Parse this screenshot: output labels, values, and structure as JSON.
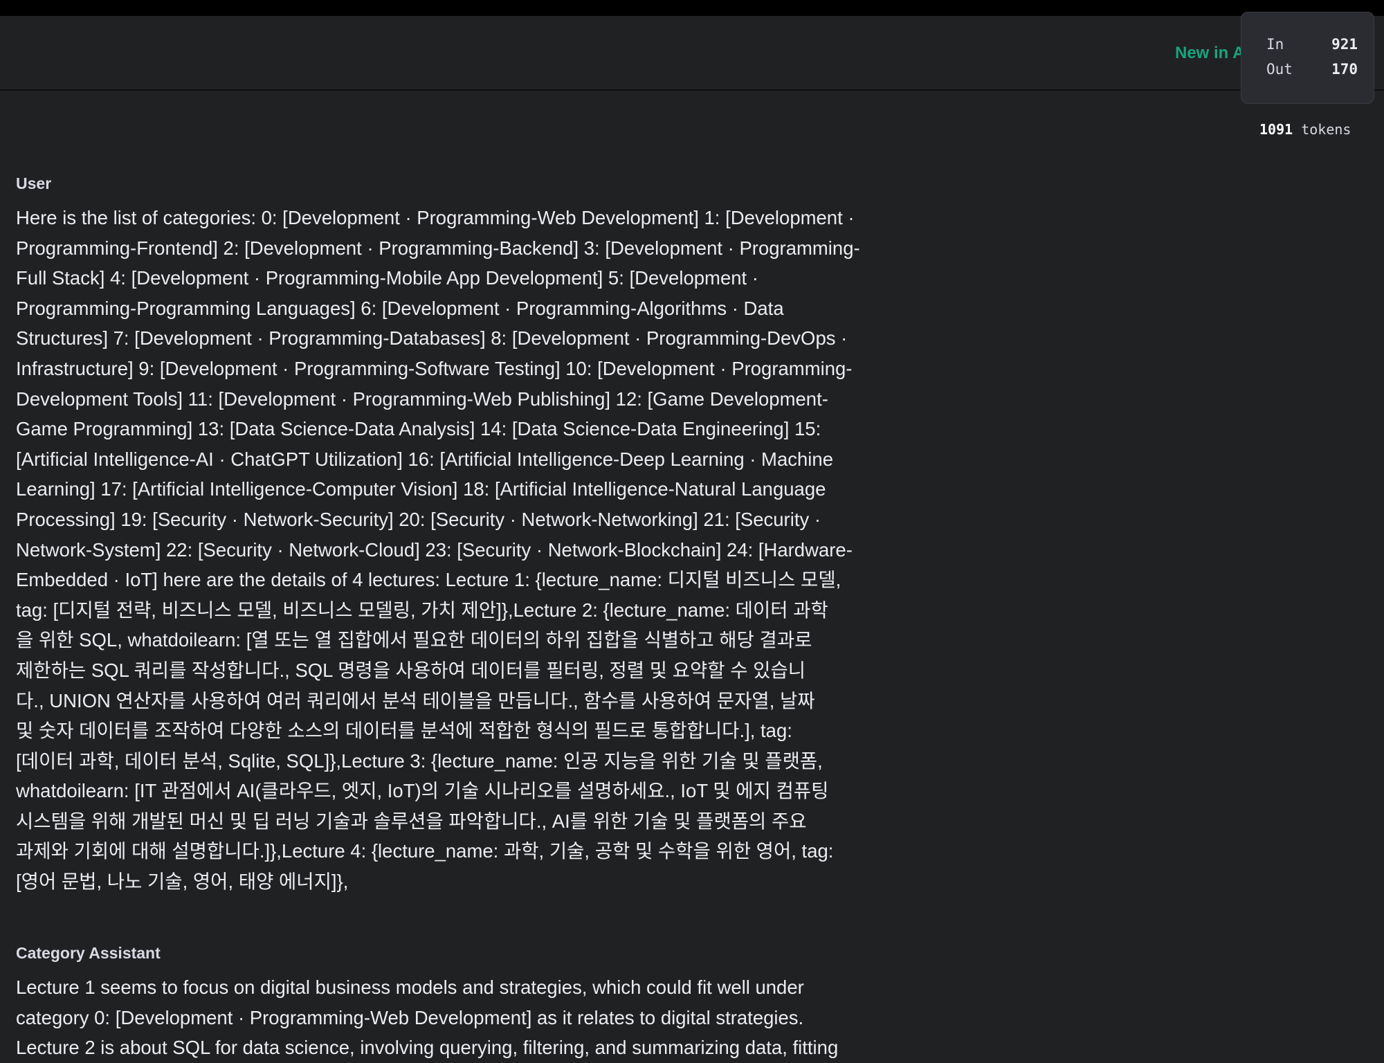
{
  "header": {
    "new_label": "New in A"
  },
  "stats": {
    "in_label": "In",
    "in_value": "921",
    "out_label": "Out",
    "out_value": "170",
    "tokens_count": "1091",
    "tokens_unit": "tokens"
  },
  "messages": [
    {
      "role": "User",
      "lines": [
        "Here is the list of categories: 0: [Development · Programming-Web Development] 1: [Development ·",
        "Programming-Frontend] 2: [Development · Programming-Backend] 3: [Development · Programming-",
        "Full Stack] 4: [Development · Programming-Mobile App Development] 5: [Development ·",
        "Programming-Programming Languages] 6: [Development · Programming-Algorithms · Data",
        "Structures] 7: [Development · Programming-Databases] 8: [Development · Programming-DevOps ·",
        "Infrastructure] 9: [Development · Programming-Software Testing] 10: [Development · Programming-",
        "Development Tools] 11: [Development · Programming-Web Publishing] 12: [Game Development-",
        "Game Programming] 13: [Data Science-Data Analysis] 14: [Data Science-Data Engineering] 15:",
        "[Artificial Intelligence-AI · ChatGPT Utilization] 16: [Artificial Intelligence-Deep Learning · Machine",
        "Learning] 17: [Artificial Intelligence-Computer Vision] 18: [Artificial Intelligence-Natural Language",
        "Processing] 19: [Security · Network-Security] 20: [Security · Network-Networking] 21: [Security ·",
        "Network-System] 22: [Security · Network-Cloud] 23: [Security · Network-Blockchain] 24: [Hardware-",
        "Embedded · IoT] here are the details of 4 lectures: Lecture 1: {lecture_name: 디지털 비즈니스 모델,",
        "tag: [디지털 전략, 비즈니스 모델, 비즈니스 모델링, 가치 제안]},Lecture 2: {lecture_name: 데이터 과학",
        "을 위한 SQL, whatdoilearn: [열 또는 열 집합에서 필요한 데이터의 하위 집합을 식별하고 해당 결과로",
        "제한하는 SQL 쿼리를 작성합니다., SQL 명령을 사용하여 데이터를 필터링, 정렬 및 요약할 수 있습니",
        "다., UNION 연산자를 사용하여 여러 쿼리에서 분석 테이블을 만듭니다., 함수를 사용하여 문자열, 날짜",
        "및 숫자 데이터를 조작하여 다양한 소스의 데이터를 분석에 적합한 형식의 필드로 통합합니다.], tag:",
        "[데이터 과학, 데이터 분석, Sqlite, SQL]},Lecture 3: {lecture_name: 인공 지능을 위한 기술 및 플랫폼,",
        "whatdoilearn: [IT 관점에서 AI(클라우드, 엣지, IoT)의 기술 시나리오를 설명하세요., IoT 및 에지 컴퓨팅",
        "시스템을 위해 개발된 머신 및 딥 러닝 기술과 솔루션을 파악합니다., AI를 위한 기술 및 플랫폼의 주요",
        "과제와 기회에 대해 설명합니다.]},Lecture 4: {lecture_name: 과학, 기술, 공학 및 수학을 위한 영어, tag:",
        "[영어 문법, 나노 기술, 영어, 태양 에너지]},"
      ]
    },
    {
      "role": "Category Assistant",
      "lines": [
        "Lecture 1 seems to focus on digital business models and strategies, which could fit well under",
        "category 0: [Development · Programming-Web Development] as it relates to digital strategies.",
        "Lecture 2 is about SQL for data science, involving querying, filtering, and summarizing data, fitting"
      ]
    }
  ]
}
